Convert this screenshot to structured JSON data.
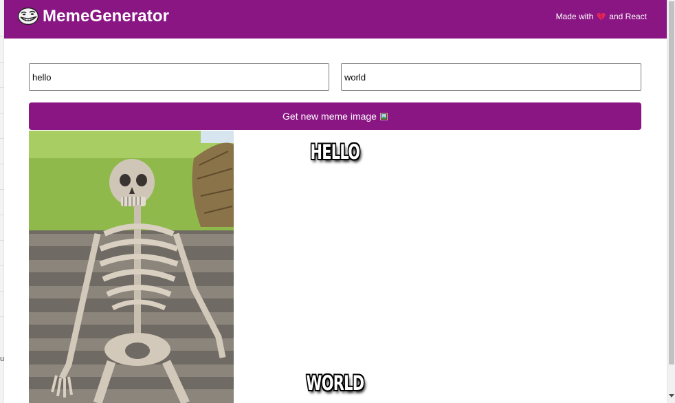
{
  "header": {
    "brand": "MemeGenerator",
    "tagline_before": "Made with",
    "tagline_after": "and React",
    "logo_icon": "troll-face-icon",
    "heart_icon": "heart-icon",
    "background_color": "#8a1684"
  },
  "form": {
    "top_text_value": "hello",
    "bottom_text_value": "world",
    "button_label": "Get new meme image",
    "button_icon": "framed-picture-icon",
    "accent_color": "#8a1684"
  },
  "meme": {
    "image": "waiting-skeleton-on-bench",
    "top_caption": "HELLO",
    "bottom_caption": "WORLD"
  },
  "background_page": {
    "partial_letter": "u"
  }
}
